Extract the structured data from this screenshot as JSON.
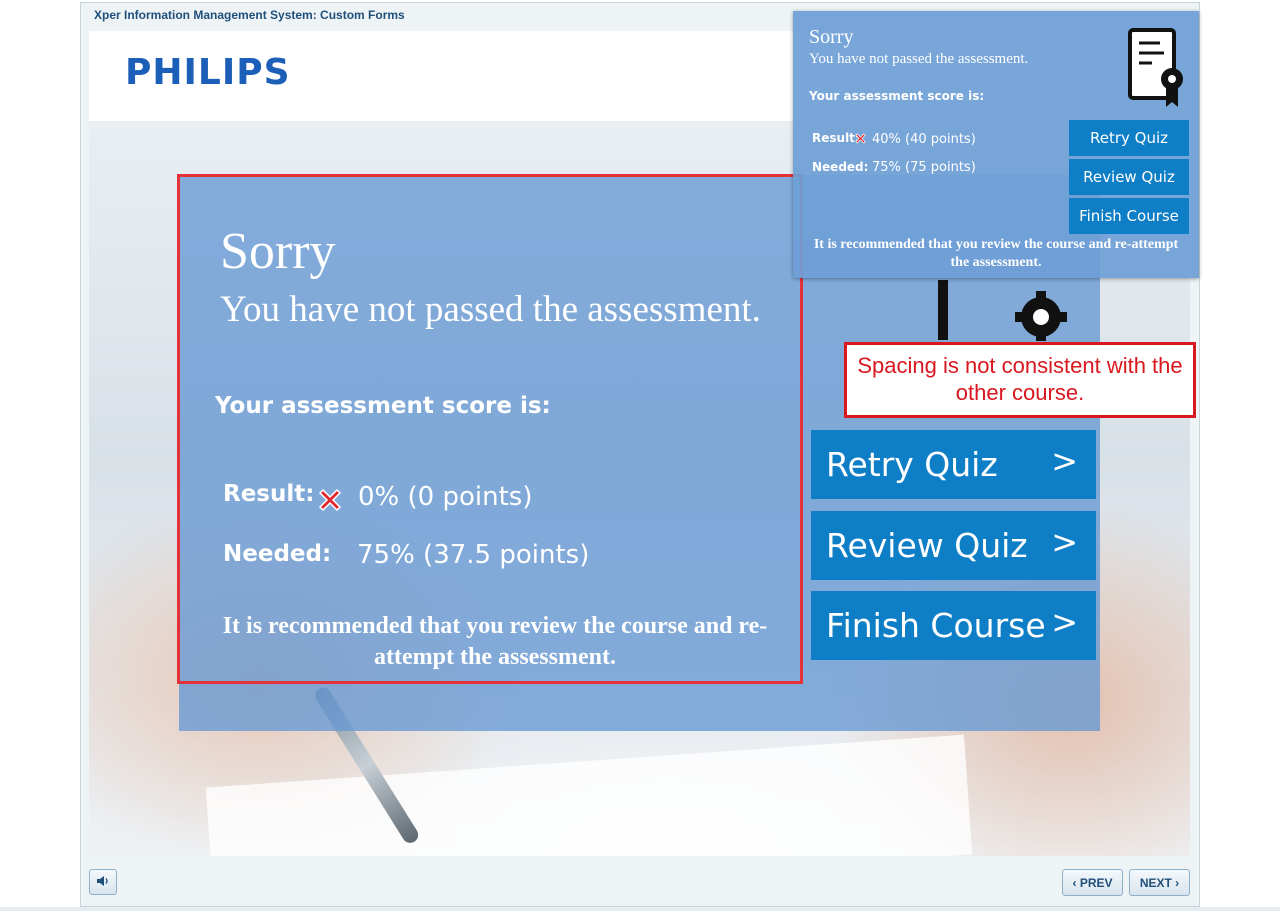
{
  "window": {
    "title": "Xper Information Management System: Custom Forms"
  },
  "brand": {
    "logo_text": "PHILIPS",
    "logo_color": "#1c5fb8"
  },
  "result_panel": {
    "heading": "Sorry",
    "subtitle": "You have not passed the assessment.",
    "score_label": "Your assessment score is:",
    "result_label": "Result:",
    "result_value": "0% (0 points)",
    "result_icon": "red-x-icon",
    "needed_label": "Needed:",
    "needed_value": "75% (37.5 points)",
    "recommendation": "It is recommended that you review the course and re-attempt the assessment.",
    "buttons": [
      {
        "label": "Retry Quiz",
        "chevron": ">"
      },
      {
        "label": "Review Quiz",
        "chevron": ">"
      },
      {
        "label": "Finish Course",
        "chevron": ">"
      }
    ],
    "button_color": "#0e7ec6",
    "highlight_border_color": "#e53238"
  },
  "reference_panel": {
    "heading": "Sorry",
    "subtitle": "You have not passed the assessment.",
    "score_label": "Your assessment score is:",
    "result_label": "Result:",
    "result_value": "40% (40 points)",
    "needed_label": "Needed:",
    "needed_value": "75% (75 points)",
    "recommendation": "It is recommended that you review the course and re-attempt the assessment.",
    "icon": "certificate-gear-icon",
    "buttons": [
      {
        "label": "Retry Quiz"
      },
      {
        "label": "Review Quiz"
      },
      {
        "label": "Finish Course"
      }
    ]
  },
  "annotation": {
    "text": "Spacing is not consistent with the other course.",
    "color": "#d9171e"
  },
  "footer": {
    "audio_icon": "speaker-icon",
    "prev_label": "PREV",
    "next_label": "NEXT",
    "prev_icon": "chevron-left-icon",
    "next_icon": "chevron-right-icon"
  }
}
